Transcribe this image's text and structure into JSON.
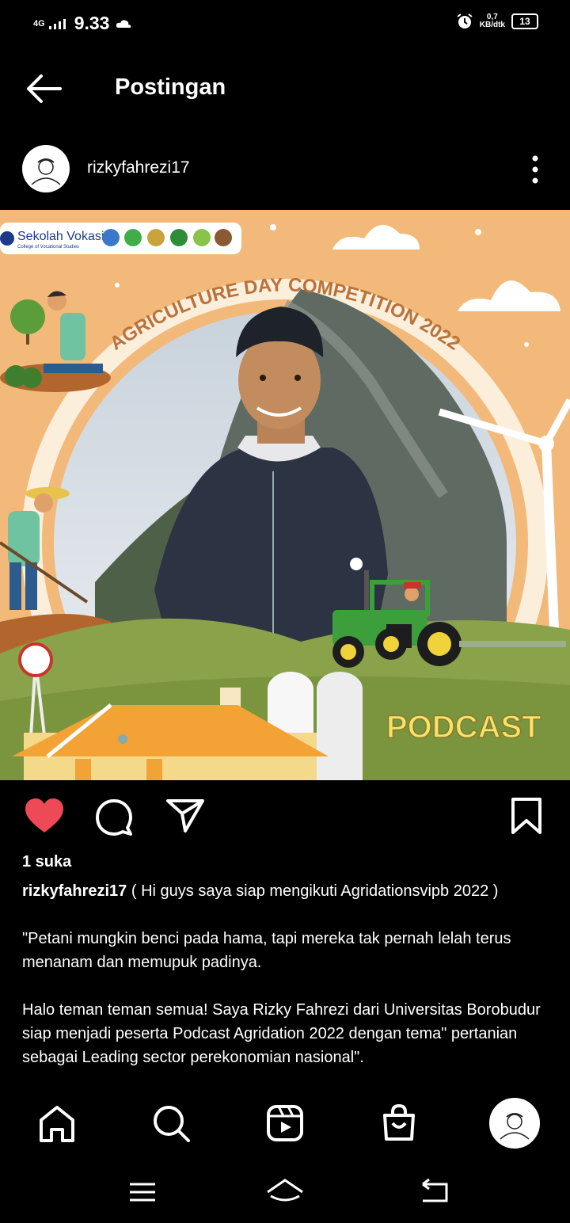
{
  "status": {
    "network": "4G",
    "time": "9.33",
    "speed_value": "0,7",
    "speed_unit": "KB/dtk",
    "battery": "13"
  },
  "header": {
    "title": "Postingan"
  },
  "post": {
    "username": "rizkyfahrezi17",
    "image": {
      "logo_text": "Sekolah Vokasi",
      "logo_subtext": "College of Vocational Studies",
      "headline": "AGRICULTURE DAY COMPETITION 2022",
      "badge": "PODCAST"
    },
    "likes": "1 suka",
    "caption_user": "rizkyfahrezi17",
    "caption_first": "( Hi guys saya siap mengikuti Agridationsvipb 2022 )",
    "caption_quote": "\"Petani mungkin benci pada hama, tapi mereka tak pernah lelah terus menanam dan memupuk padinya.",
    "caption_body": "Halo teman teman semua! Saya Rizky Fahrezi dari Universitas Borobudur siap menjadi peserta Podcast Agridation 2022 dengan tema\" pertanian sebagai Leading sector perekonomian nasional\"."
  },
  "icons": {
    "back": "arrow-left-icon",
    "more": "more-vertical-icon",
    "like": "heart-icon",
    "comment": "comment-icon",
    "share": "send-icon",
    "save": "bookmark-icon",
    "home": "home-icon",
    "search": "search-icon",
    "reels": "reels-icon",
    "shop": "shopping-bag-icon"
  },
  "colors": {
    "background": "#000000",
    "like": "#ed4956",
    "image_bg": "#f2b97a",
    "headline": "#b9723a",
    "badge": "#f5e36a"
  }
}
